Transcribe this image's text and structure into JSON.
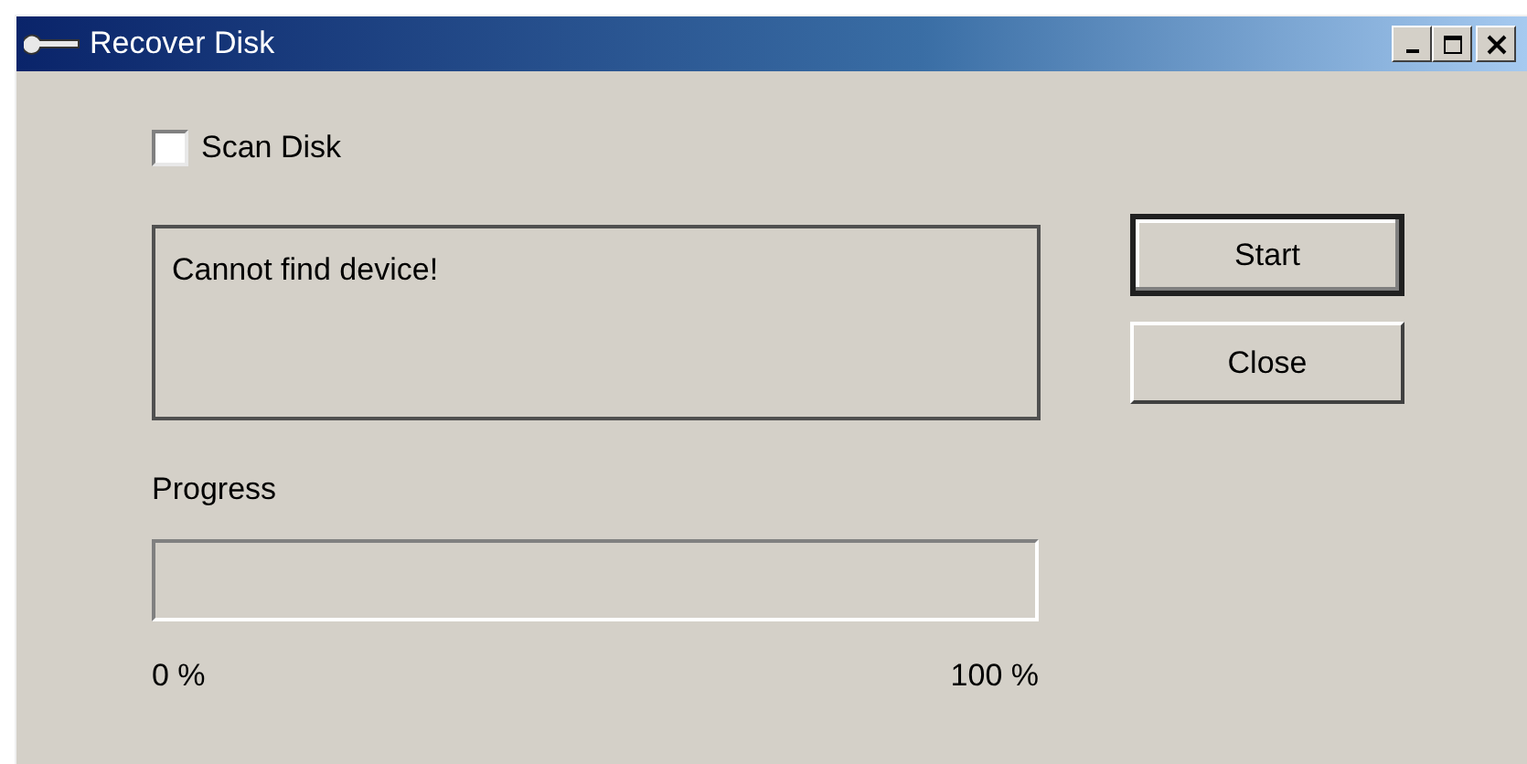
{
  "window": {
    "title": "Recover Disk"
  },
  "title_buttons": [
    {
      "kind": "minimize"
    },
    {
      "kind": "maximize"
    },
    {
      "kind": "close"
    }
  ],
  "scan_disk": {
    "label": "Scan Disk",
    "checked": false
  },
  "message": "Cannot find device!",
  "buttons": [
    {
      "label": "Start",
      "default": true
    },
    {
      "label": "Close",
      "default": false
    }
  ],
  "progress": {
    "label": "Progress",
    "level": 0,
    "min_label": "0 %",
    "max_label": "100 %"
  }
}
